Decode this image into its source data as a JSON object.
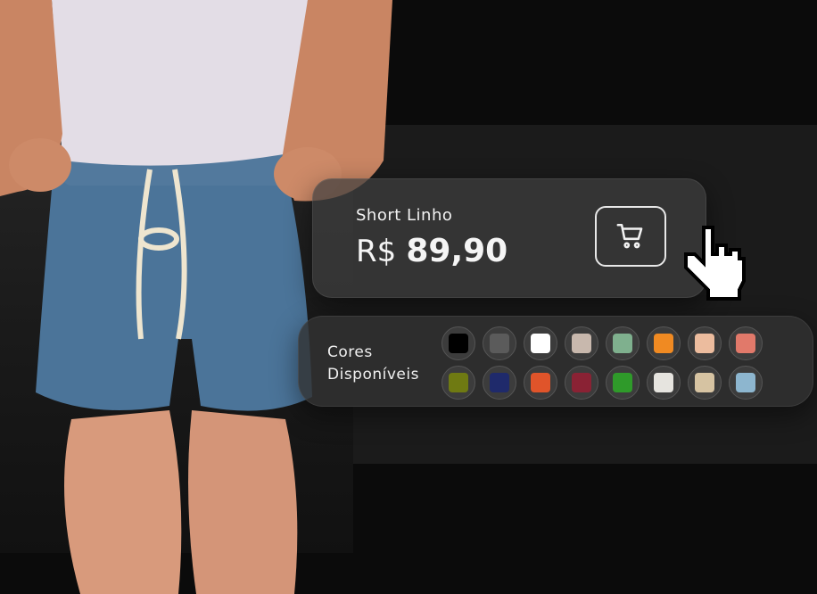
{
  "product": {
    "name": "Short Linho",
    "currency": "R$",
    "price": "89,90"
  },
  "cart_button": {
    "icon": "cart-icon"
  },
  "cursor": {
    "icon": "pointer-hand-icon"
  },
  "colors": {
    "label_line1": "Cores",
    "label_line2": "Disponíveis",
    "swatches": [
      "#000000",
      "#5b5b5b",
      "#ffffff",
      "#c8b8ad",
      "#7fb08e",
      "#f08a22",
      "#ecbc9e",
      "#e1796a",
      "#6f7a12",
      "#1f2a6b",
      "#e0542a",
      "#8a2234",
      "#2f9a2a",
      "#e6e4df",
      "#d6c3a2",
      "#8db6cf"
    ]
  },
  "theme": {
    "background": "#0b0b0b",
    "panel": "#1b1b1b",
    "text": "#f2f2f2"
  }
}
